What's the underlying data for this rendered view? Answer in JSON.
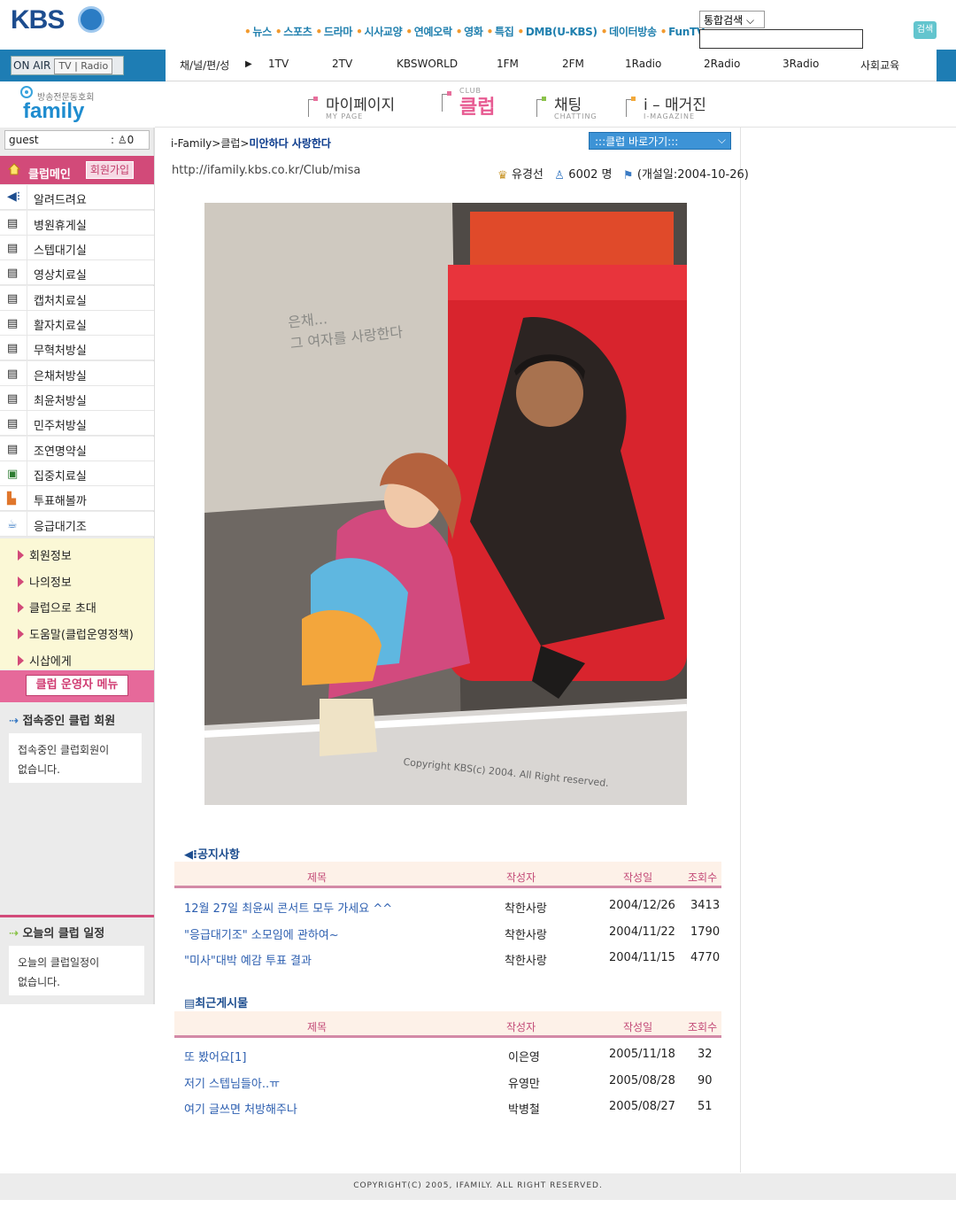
{
  "header": {
    "logo": "KBS",
    "top_links": [
      "뉴스",
      "스포츠",
      "드라마",
      "시사교양",
      "연예오락",
      "영화",
      "특집",
      "DMB(U-KBS)",
      "데이터방송",
      "FunTV"
    ],
    "search_select": "통합검색",
    "search_button": "검색"
  },
  "nav": {
    "onair": "ON AIR",
    "tv": "TV",
    "radio": "Radio",
    "items": [
      "채/널/편/성",
      "▶",
      "1TV",
      "2TV",
      "KBSWORLD",
      "1FM",
      "2FM",
      "1Radio",
      "2Radio",
      "3Radio",
      "사회교육"
    ]
  },
  "family": {
    "sub": "방송전문동호회",
    "word": "family",
    "menus": [
      {
        "big": "마이페이지",
        "small": "MY PAGE"
      },
      {
        "big": "클럽",
        "small": "CLUB"
      },
      {
        "big": "채팅",
        "small": "CHATTING"
      },
      {
        "big": "i – 매거진",
        "small": "I-MAGAZINE"
      }
    ]
  },
  "sidebar": {
    "guest": "guest",
    "guest_count_prefix": ":",
    "guest_count": "0",
    "club_main": "클럽메인",
    "join": "회원가입",
    "items": [
      "알려드려요",
      "병원휴게실",
      "스텝대기실",
      "영상치료실",
      "캡처치료실",
      "활자치료실",
      "무혁처방실",
      "은채처방실",
      "최윤처방실",
      "민주처방실",
      "조연명약실",
      "집중치료실",
      "투표해볼까",
      "응급대기조"
    ],
    "info": [
      "회원정보",
      "나의정보",
      "클럽으로 초대",
      "도움말(클럽운영정책)",
      "시삽에게"
    ],
    "op_menu": "클럽 운영자 메뉴",
    "online_title": "접속중인 클럽 회원",
    "online_text_1": "접속중인 클럽회원이",
    "online_text_2": "없습니다.",
    "schedule_title": "오늘의 클럽 일정",
    "schedule_text_1": "오늘의 클럽일정이",
    "schedule_text_2": "없습니다."
  },
  "breadcrumb": {
    "path": "i-Family>클럽>",
    "current": "미안하다 사랑한다",
    "club_go": ":::클럽 바로가기:::"
  },
  "club": {
    "url": "http://ifamily.kbs.co.kr/Club/misa",
    "owner": "유경선",
    "members": "6002 명",
    "opened": "(개설일:2004-10-26)",
    "photo_text_1": "은채...",
    "photo_text_2": "그 여자를 사랑한다",
    "photo_copyright": "Copyright KBS(c) 2004. All Right reserved."
  },
  "notice": {
    "title": "공지사항",
    "headers": [
      "제목",
      "작성자",
      "작성일",
      "조회수"
    ],
    "rows": [
      [
        "12월 27일 최윤씨 콘서트 모두 가세요 ^^",
        "착한사랑",
        "2004/12/26",
        "3413"
      ],
      [
        "\"응급대기조\" 소모임에 관하여~",
        "착한사랑",
        "2004/11/22",
        "1790"
      ],
      [
        "\"미사\"대박 예감 투표 결과",
        "착한사랑",
        "2004/11/15",
        "4770"
      ]
    ]
  },
  "recent": {
    "title": "최근게시물",
    "headers": [
      "제목",
      "작성자",
      "작성일",
      "조회수"
    ],
    "rows": [
      [
        "또 봤어요[1]",
        "이은영",
        "2005/11/18",
        "32"
      ],
      [
        "저기 스텝님들아..ㅠ",
        "유영만",
        "2005/08/28",
        "90"
      ],
      [
        "여기 글쓰면 처방해주나",
        "박병철",
        "2005/08/27",
        "51"
      ]
    ]
  },
  "footer": "COPYRIGHT(C) 2005, IFAMILY. ALL RIGHT RESERVED.",
  "colors": {
    "nav_blue": "#1e7db4",
    "club_pink": "#d24a79",
    "link_blue": "#2d5fb0"
  }
}
